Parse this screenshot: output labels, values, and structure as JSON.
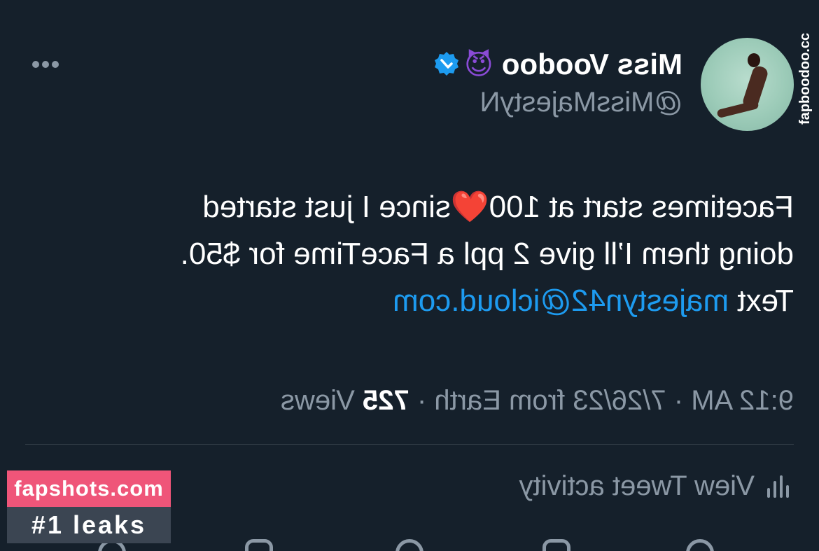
{
  "tweet": {
    "author": {
      "display_name": "Miss Voodoo",
      "name_emoji": "😈",
      "handle": "@MissMajestyN",
      "verified": true
    },
    "text": {
      "line1": "Facetimes start at 100",
      "heart_emoji": "❤️",
      "line1b": "since I just started",
      "line2": "doing them I’ll give 2 ppl a FaceTime for $50.",
      "line3_prefix": "Text ",
      "email": "majestyn42@icloud.com"
    },
    "meta": {
      "time": "9:12 AM",
      "separator": "·",
      "date_location": "7/26/23 from Earth",
      "views_count": "725",
      "views_label": "Views"
    },
    "activity_label": "View Tweet activity"
  },
  "watermark": {
    "site": "fapshots.com",
    "tagline": "#1 leaks",
    "vertical_site": "fapboodoo.cc"
  },
  "icons": {
    "more": "more-horizontal-icon",
    "verified": "verified-badge-icon",
    "activity": "bar-chart-icon"
  },
  "colors": {
    "background": "#15202b",
    "text_primary": "#ffffff",
    "text_secondary": "#8b98a5",
    "link": "#1d9bf0",
    "verified": "#1d9bf0",
    "watermark_pink": "#ef5579",
    "watermark_gray": "#3b4552"
  }
}
